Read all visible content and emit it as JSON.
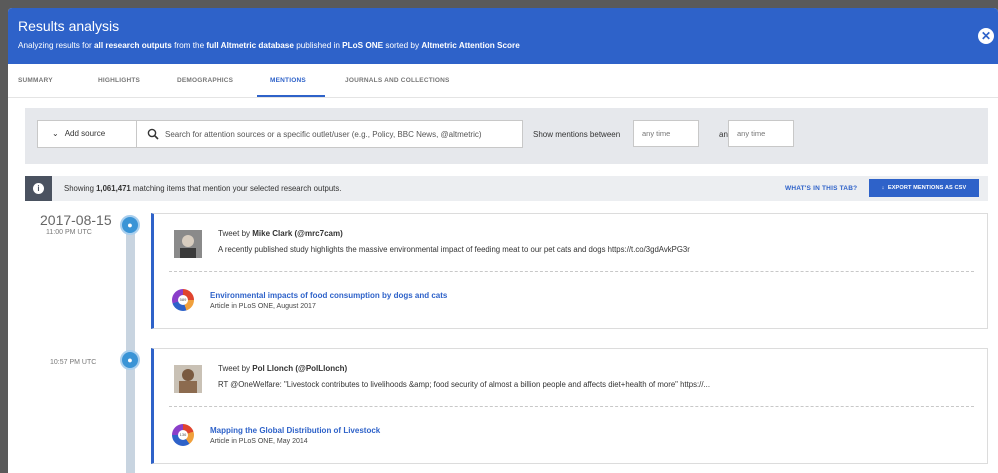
{
  "header": {
    "title": "Results analysis",
    "subtitle_prefix": "Analyzing results for ",
    "subtitle_b1": "all research outputs",
    "subtitle_mid1": " from the ",
    "subtitle_b2": "full Altmetric database",
    "subtitle_mid2": " published in ",
    "subtitle_b3": "PLoS ONE",
    "subtitle_mid3": " sorted by ",
    "subtitle_b4": "Altmetric Attention Score",
    "close_glyph": "✕"
  },
  "tabs": [
    {
      "label": "SUMMARY"
    },
    {
      "label": "HIGHLIGHTS"
    },
    {
      "label": "DEMOGRAPHICS"
    },
    {
      "label": "MENTIONS"
    },
    {
      "label": "JOURNALS AND COLLECTIONS"
    }
  ],
  "active_tab": "MENTIONS",
  "filters": {
    "add_source_label": "Add source",
    "search_placeholder": "Search for attention sources or a specific outlet/user (e.g., Policy, BBC News, @altmetric)",
    "show_between_label": "Show mentions between",
    "from_placeholder": "any time",
    "and_label": "and",
    "to_placeholder": "any time"
  },
  "info_bar": {
    "prefix": "Showing ",
    "count": "1,061,471",
    "suffix": " matching items that mention your selected research outputs.",
    "whats_in_tab": "WHAT'S IN THIS TAB?",
    "export_label": "EXPORT MENTIONS AS CSV"
  },
  "timeline": {
    "date": "2017-08-15",
    "mentions": [
      {
        "time": "11:00 PM UTC",
        "tweet_prefix": "Tweet by ",
        "author": "Mike Clark (@mrc7cam)",
        "text": "A recently published study highlights the massive environmental impact of feeding meat to our pet cats and dogs https://t.co/3gdAvkPG3r",
        "article_title": "Environmental impacts of food consumption by dogs and cats",
        "article_sub": "Article in PLoS ONE, August 2017",
        "score": "589"
      },
      {
        "time": "10:57 PM UTC",
        "tweet_prefix": "Tweet by ",
        "author": "Pol Llonch (@PolLlonch)",
        "text": "RT @OneWelfare: \"Livestock contributes to livelihoods &amp; food security of almost a billion people and affects diet+health of more\" https://...",
        "article_title": "Mapping the Global Distribution of Livestock",
        "article_sub": "Article in PLoS ONE, May 2014",
        "score": "136"
      }
    ]
  },
  "colors": {
    "brand_blue": "#2e62c9",
    "twitter_blue": "#3a94d6"
  }
}
